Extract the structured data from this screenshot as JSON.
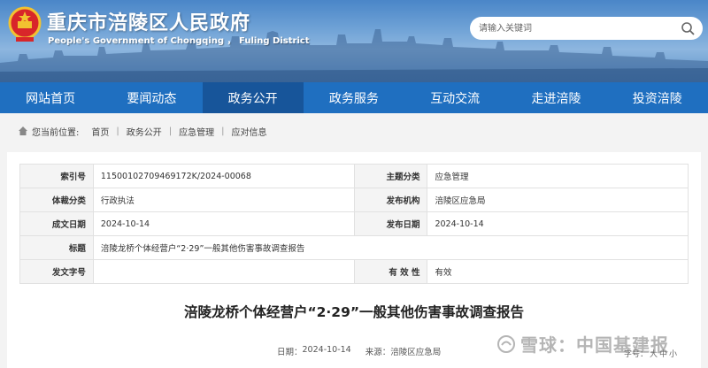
{
  "header": {
    "site_title": "重庆市涪陵区人民政府",
    "site_subtitle": "People's Government of Chongqing ， Fuling District",
    "search_placeholder": "请输入关键词"
  },
  "nav": {
    "items": [
      {
        "label": "网站首页"
      },
      {
        "label": "要闻动态"
      },
      {
        "label": "政务公开"
      },
      {
        "label": "政务服务"
      },
      {
        "label": "互动交流"
      },
      {
        "label": "走进涪陵"
      },
      {
        "label": "投资涪陵"
      }
    ],
    "active_index": 2
  },
  "breadcrumb": {
    "location_label": "您当前位置:",
    "items": [
      "首页",
      "政务公开",
      "应急管理",
      "应对信息"
    ]
  },
  "meta": {
    "index_label": "索引号",
    "index_value": "11500102709469172K/2024-00068",
    "topic_label": "主题分类",
    "topic_value": "应急管理",
    "genre_label": "体裁分类",
    "genre_value": "行政执法",
    "issuer_label": "发布机构",
    "issuer_value": "涪陵区应急局",
    "created_label": "成文日期",
    "created_value": "2024-10-14",
    "published_label": "发布日期",
    "published_value": "2024-10-14",
    "title_label": "标题",
    "title_value": "涪陵龙桥个体经营户“2·29”一般其他伤害事故调查报告",
    "docno_label": "发文字号",
    "docno_value": "",
    "validity_label": "有 效 性",
    "validity_value": "有效"
  },
  "article": {
    "title": "涪陵龙桥个体经营户“2·29”一般其他伤害事故调查报告",
    "date_label": "日期：",
    "date_value": "2024-10-14",
    "source_label": "来源：",
    "source_value": "涪陵区应急局"
  },
  "font_size": {
    "label": "字号：",
    "large": "大",
    "medium": "中",
    "small": "小"
  },
  "watermark": {
    "text": "雪球：中国基建报"
  },
  "colors": {
    "nav_bg": "#1f6fc0",
    "nav_active": "#17559a",
    "label_bg": "#f4f4f4"
  }
}
